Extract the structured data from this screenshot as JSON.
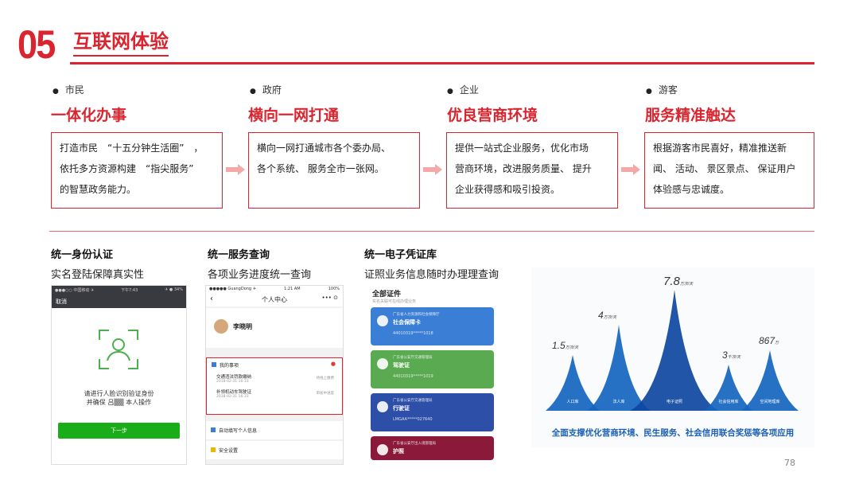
{
  "header": {
    "number": "05",
    "title": "互联网体验"
  },
  "columns": [
    {
      "category": "市民",
      "heading": "一体化办事",
      "lines": [
        "打造市民　“十五分钟生活圈”　，",
        "依托多方资源构建　“指尖服务”",
        "的智慧政务能力。"
      ]
    },
    {
      "category": "政府",
      "heading": "横向一网打通",
      "lines": [
        "横向一网打通城市各个委办局、",
        "各个系统、 服务全市一张网。"
      ]
    },
    {
      "category": "企业",
      "heading": "优良营商环境",
      "lines": [
        "提供一站式企业服务，优化市场",
        "营商环境，改进服务质量、 提升",
        "企业获得感和吸引投资。"
      ]
    },
    {
      "category": "游客",
      "heading": "服务精准触达",
      "lines": [
        "根据游客市民喜好，精准推送新",
        "闻、 活动、 景区景点、 保证用户",
        "体验感与忠诚度。"
      ]
    }
  ],
  "sections": [
    {
      "heading": "统一身份认证",
      "desc": "实名登陆保障真实性"
    },
    {
      "heading": "统一服务查询",
      "desc": "各项业务进度统一查询"
    },
    {
      "heading": "统一电子凭证库",
      "desc": "证照业务信息随时办理理查询"
    }
  ],
  "phone1": {
    "status_left": "●●●○○ 中国移动 ✈",
    "status_mid": "下午7:43",
    "status_right": "✈ ● 34%",
    "nav": "取消",
    "prompt_line1": "请进行人脸识别验证身份",
    "prompt_line2": "并确保 吕▒▒ 本人操作",
    "button": "下一步"
  },
  "phone2": {
    "status_left": "●●●●● GuangDong ✈",
    "status_mid": "1:21 AM",
    "status_right": "100%",
    "title": "个人中心",
    "user": "李晓明",
    "row1": "我的事项",
    "row1_badge": "●",
    "item1": "交通违法罚款缴纳",
    "item1_date": "2018-02-31 16:33",
    "item1_status": "待线上缴费",
    "item2": "补领机动车驾驶证",
    "item2_date": "2018-02-31 16:33",
    "item2_status": "审核中进度",
    "row2": "自动填写个人信息",
    "row3": "安全设置"
  },
  "phone3": {
    "title": "全部证件",
    "subtitle": "实名关联可在线办理业务",
    "cards": [
      {
        "org": "广东省人力资源和社会保障厅",
        "name": "社会保障卡",
        "num": "44010319*****1018",
        "color": "#3a7fd5"
      },
      {
        "org": "广东省公安厅交通管理局",
        "name": "驾驶证",
        "num": "44010319*****1019",
        "color": "#5aaa52"
      },
      {
        "org": "广东省公安厅交通管理局",
        "name": "行驶证",
        "num": "LMGAA*****027640",
        "color": "#2d4fa8"
      },
      {
        "org": "广东省公安厅出入境管理局",
        "name": "护照",
        "num": "",
        "color": "#8b1a3a"
      }
    ]
  },
  "chart": {
    "peaks": [
      {
        "label": "人口库",
        "value": "1.5",
        "unit": "万次/天"
      },
      {
        "label": "法人库",
        "value": "4",
        "unit": "万次/天"
      },
      {
        "label": "电子证照",
        "value": "7.8",
        "unit": "万次/天"
      },
      {
        "label": "社会信用库",
        "value": "3",
        "unit": "千次/天"
      },
      {
        "label": "空间地理库",
        "value": "867",
        "unit": "万"
      }
    ],
    "caption": "全面支撑优化营商环境、民生服务、社会信用联合奖惩等各项应用"
  },
  "page_number": "78",
  "colors": {
    "accent": "#d9252f",
    "arrow": "#f4a9a9",
    "blue": "#1a5fb4"
  }
}
